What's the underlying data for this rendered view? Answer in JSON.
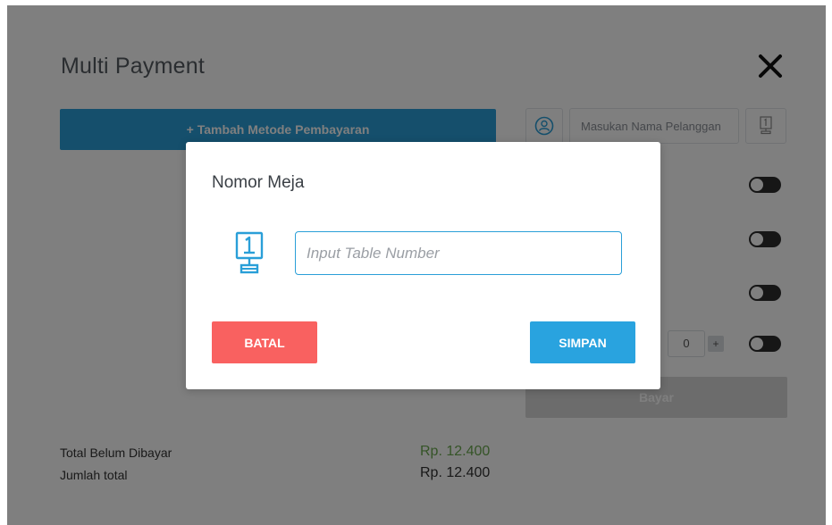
{
  "page": {
    "title": "Multi Payment",
    "add_method_label": "+ Tambah Metode Pembayaran",
    "customer_placeholder": "Masukan Nama Pelanggan",
    "qty_value": "0",
    "qty_plus": "+",
    "pay_label": "Bayar"
  },
  "summary": {
    "unpaid_label": "Total Belum Dibayar",
    "unpaid_value": "Rp. 12.400",
    "total_label": "Jumlah total",
    "total_value": "Rp. 12.400"
  },
  "modal": {
    "title": "Nomor Meja",
    "input_placeholder": "Input Table Number",
    "cancel_label": "BATAL",
    "save_label": "SIMPAN"
  },
  "icons": {
    "close": "close-icon",
    "user": "user-circle-icon",
    "table": "table-number-icon"
  },
  "colors": {
    "primary": "#2a9fd8",
    "danger": "#f96160",
    "success": "#6aa84f",
    "disabled": "#d8d8d8"
  }
}
